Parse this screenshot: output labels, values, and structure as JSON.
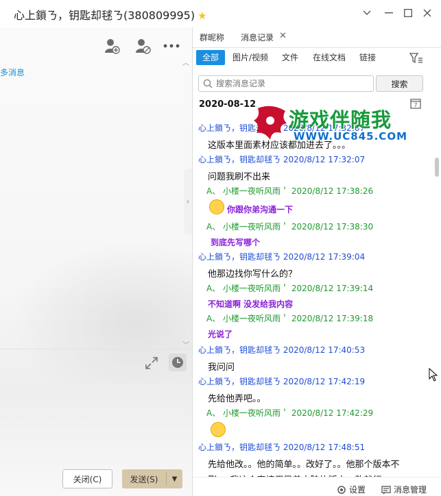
{
  "window": {
    "title": "心上鎖ㄋ，钥匙却毬ㄋ(380809995)",
    "star_icon": "star-icon",
    "controls": [
      "chevron-down-icon",
      "minimize-icon",
      "maximize-icon",
      "close-icon"
    ]
  },
  "left_panel": {
    "more_messages_link": "多消息",
    "close_label": "关闭(C)",
    "send_label": "发送(S)"
  },
  "right_panel": {
    "tabs": [
      {
        "label": "群昵称"
      },
      {
        "label": "消息记录"
      }
    ],
    "filters": [
      {
        "label": "全部"
      },
      {
        "label": "图片/视频"
      },
      {
        "label": "文件"
      },
      {
        "label": "在线文档"
      },
      {
        "label": "链接"
      }
    ],
    "search": {
      "placeholder": "搜索消息记录",
      "button": "搜索"
    },
    "date_header": "2020-08-12",
    "messages": [
      {
        "sender": "心上鎖ㄋ，钥匙却毬ㄋ",
        "time": "2020/8/12 17:32:07",
        "type": "me",
        "text": "这版本里面素材应该都加进去了。。。"
      },
      {
        "sender": "心上鎖ㄋ，钥匙却毬ㄋ",
        "time": "2020/8/12 17:32:07",
        "type": "me",
        "text": "问题我刷不出来"
      },
      {
        "sender": "A、 小楼一夜听风雨＇",
        "time": "2020/8/12 17:38:26",
        "type": "other",
        "text": "你跟你弟沟通一下",
        "emoji": true
      },
      {
        "sender": "A、 小楼一夜听风雨＇",
        "time": "2020/8/12 17:38:30",
        "type": "other",
        "text": "到底先写哪个"
      },
      {
        "sender": "心上鎖ㄋ，钥匙却毬ㄋ",
        "time": "2020/8/12 17:39:04",
        "type": "me",
        "text": "他那边找你写什么的？"
      },
      {
        "sender": "A、 小楼一夜听风雨＇",
        "time": "2020/8/12 17:39:14",
        "type": "other",
        "text": "不知道啊  没发给我内容"
      },
      {
        "sender": "A、 小楼一夜听风雨＇",
        "time": "2020/8/12 17:39:18",
        "type": "other",
        "text": "光说了"
      },
      {
        "sender": "心上鎖ㄋ，钥匙却毬ㄋ",
        "time": "2020/8/12 17:40:53",
        "type": "me",
        "text": "我问问"
      },
      {
        "sender": "心上鎖ㄋ，钥匙却毬ㄋ",
        "time": "2020/8/12 17:42:19",
        "type": "me",
        "text": "先给他弄吧。。"
      },
      {
        "sender": "A、 小楼一夜听风雨＇",
        "time": "2020/8/12 17:42:29",
        "type": "other",
        "text": "",
        "emoji": true
      },
      {
        "sender": "心上鎖ㄋ，钥匙却毬ㄋ",
        "time": "2020/8/12 17:48:51",
        "type": "me",
        "text": "先给他改。。他的简单。。改好了。。他那个版本不"
      },
      {
        "text": "删。。我这个直接用异兽大陆的版本，改就行"
      }
    ],
    "footer": {
      "settings": "设置",
      "manage": "消息管理"
    }
  },
  "watermark": {
    "text": "游戏伴随我",
    "url": "WWW.UC845.COM"
  }
}
